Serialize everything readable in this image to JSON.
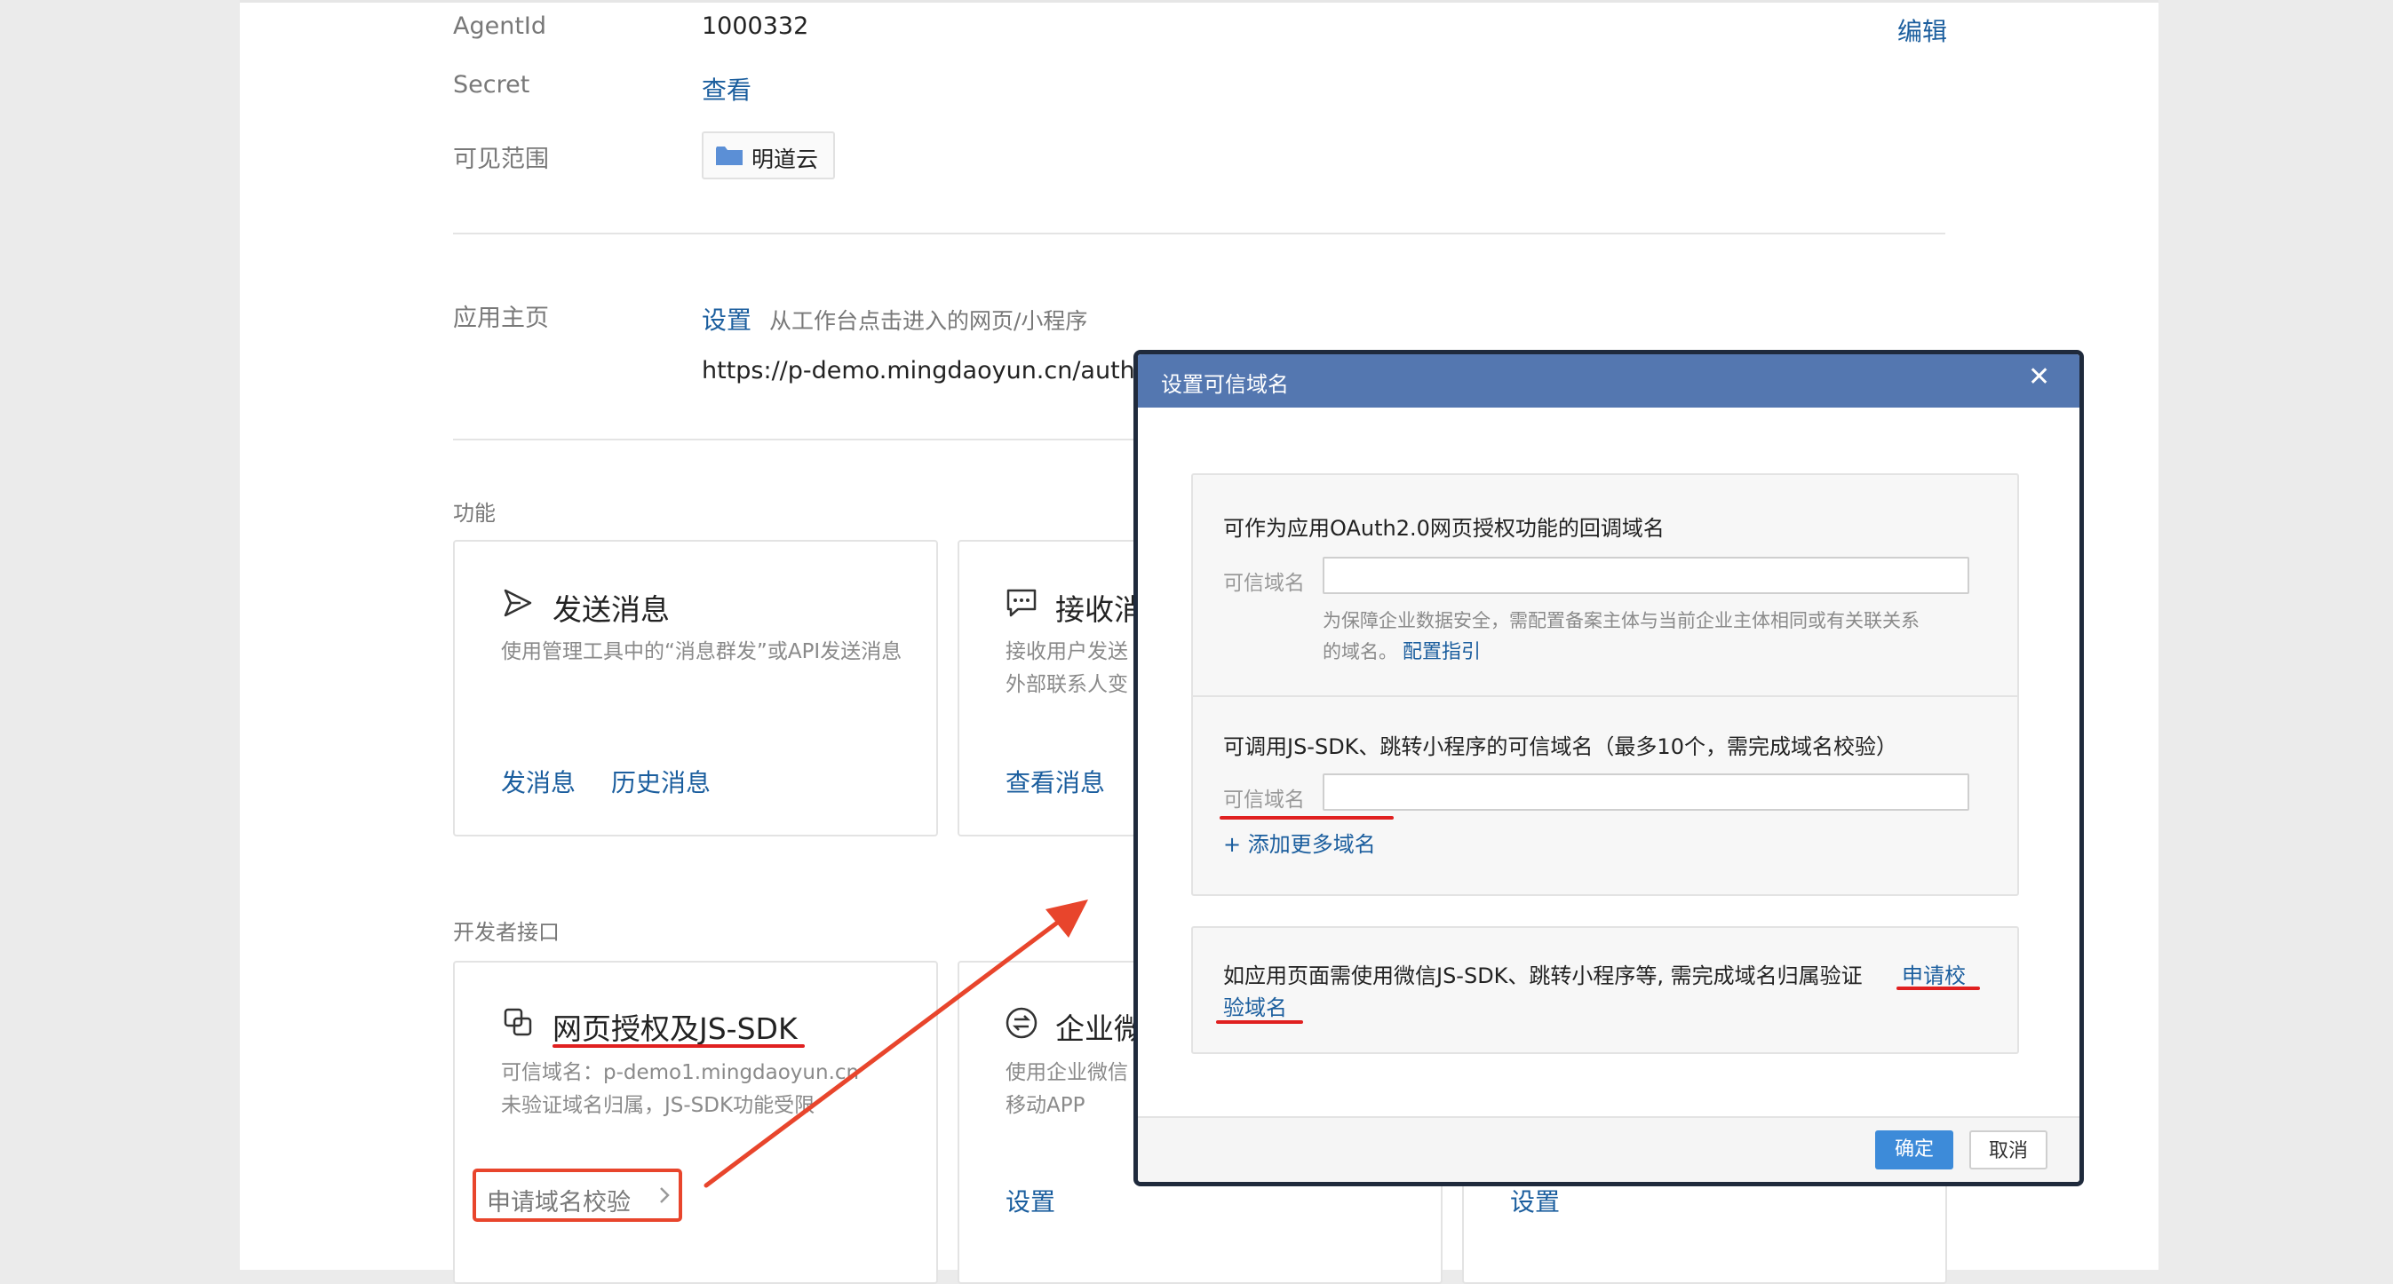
{
  "app": {
    "agentid_label": "AgentId",
    "agentid_value": "1000332",
    "edit_label": "编辑",
    "secret_label": "Secret",
    "secret_view": "查看",
    "visible_label": "可见范围",
    "visible_tag": "明道云",
    "homepage_label": "应用主页",
    "homepage_set": "设置",
    "homepage_hint": "从工作台点击进入的网页/小程序",
    "homepage_url": "https://p-demo.mingdaoyun.cn/auth/w"
  },
  "features": {
    "section_label": "功能",
    "send": {
      "title": "发送消息",
      "desc": "使用管理工具中的“消息群发”或API发送消息",
      "link1": "发消息",
      "link2": "历史消息"
    },
    "receive": {
      "title": "接收消",
      "desc_line1": "接收用户发送",
      "desc_line2": "外部联系人变",
      "link": "查看消息"
    }
  },
  "dev": {
    "section_label": "开发者接口",
    "oauth": {
      "title": "网页授权及JS-SDK",
      "desc_line1": "可信域名：p-demo1.mingdaoyun.cn",
      "desc_line2": "未验证域名归属，JS-SDK功能受限",
      "action": "申请域名校验"
    },
    "wecom": {
      "title": "企业微",
      "desc_line1": "使用企业微信",
      "desc_line2": "移动APP",
      "link": "设置"
    },
    "third": {
      "link": "设置"
    }
  },
  "modal": {
    "title": "设置可信域名",
    "close": "✕",
    "p1_title": "可作为应用OAuth2.0网页授权功能的回调域名",
    "p1_label": "可信域名",
    "p1_input": "",
    "p1_hint_line1": "为保障企业数据安全，需配置备案主体与当前企业主体相同或有关联关系",
    "p1_hint_line2": "的域名。",
    "p1_hint_link": "配置指引",
    "p2_title": "可调用JS-SDK、跳转小程序的可信域名（最多10个，需完成域名校验）",
    "p2_label": "可信域名",
    "p2_input": "",
    "p2_add": "+ 添加更多域名",
    "p3_text": "如应用页面需使用微信JS-SDK、跳转小程序等, 需完成域名归属验证",
    "p3_link_a": "申请校",
    "p3_link_b": "验域名",
    "ok": "确定",
    "cancel": "取消"
  },
  "colors": {
    "link": "#1b5e9e",
    "modal_header": "#5477b0",
    "annotation": "#e02020",
    "ok_button": "#3d8bd9"
  }
}
